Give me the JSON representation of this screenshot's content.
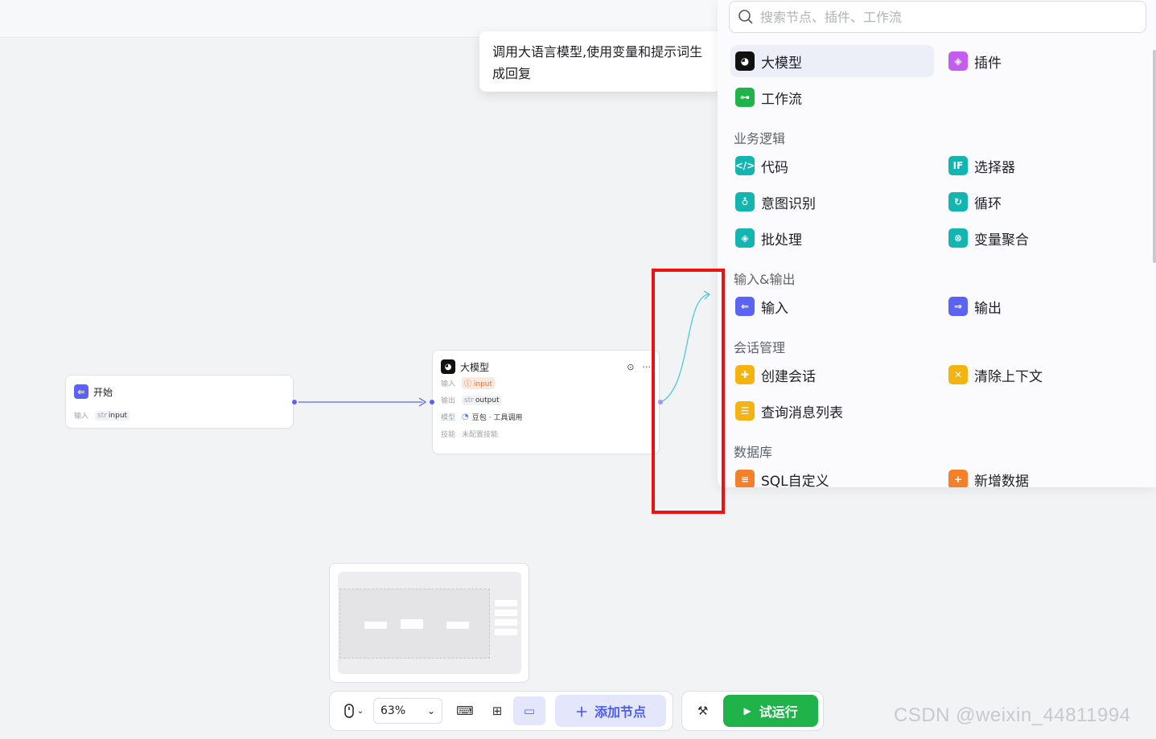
{
  "tooltip": {
    "text": "调用大语言模型,使用变量和提示词生成回复"
  },
  "nodes": {
    "start": {
      "title": "开始",
      "input_label": "输入",
      "input_type": "str",
      "input_name": "input"
    },
    "llm": {
      "title": "大模型",
      "input_label": "输入",
      "input_value": "input",
      "output_label": "输出",
      "output_type": "str",
      "output_value": "output",
      "model_label": "模型",
      "model_value": "豆包 · 工具调用",
      "skill_label": "技能",
      "skill_value": "未配置技能"
    }
  },
  "panel": {
    "search_placeholder": "搜索节点、插件、工作流",
    "top_items": [
      {
        "label": "大模型",
        "icon": "llm-icon",
        "color": "#111111"
      },
      {
        "label": "插件",
        "icon": "plugin-icon",
        "color": "#c45cf0"
      },
      {
        "label": "工作流",
        "icon": "workflow-icon",
        "color": "#1fb34a"
      }
    ],
    "sections": [
      {
        "title": "业务逻辑",
        "items": [
          {
            "label": "代码",
            "icon": "code-icon",
            "color": "#13b5b1"
          },
          {
            "label": "选择器",
            "icon": "if-icon",
            "color": "#13b5b1"
          },
          {
            "label": "意图识别",
            "icon": "intent-icon",
            "color": "#13b5b1"
          },
          {
            "label": "循环",
            "icon": "loop-icon",
            "color": "#13b5b1"
          },
          {
            "label": "批处理",
            "icon": "batch-icon",
            "color": "#13b5b1"
          },
          {
            "label": "变量聚合",
            "icon": "variable-merge-icon",
            "color": "#13b5b1"
          }
        ]
      },
      {
        "title": "输入&输出",
        "items": [
          {
            "label": "输入",
            "icon": "input-icon",
            "color": "#5b63f5"
          },
          {
            "label": "输出",
            "icon": "output-icon",
            "color": "#5b63f5"
          }
        ]
      },
      {
        "title": "会话管理",
        "items": [
          {
            "label": "创建会话",
            "icon": "create-conversation-icon",
            "color": "#f5b311"
          },
          {
            "label": "清除上下文",
            "icon": "clear-context-icon",
            "color": "#f5b311"
          },
          {
            "label": "查询消息列表",
            "icon": "message-list-icon",
            "color": "#f5b311"
          }
        ]
      },
      {
        "title": "数据库",
        "items": [
          {
            "label": "SQL自定义",
            "icon": "sql-icon",
            "color": "#f5802b"
          },
          {
            "label": "新增数据",
            "icon": "add-data-icon",
            "color": "#f5802b"
          }
        ]
      }
    ]
  },
  "toolbar": {
    "zoom": "63%",
    "add_node_label": "添加节点",
    "run_label": "试运行"
  },
  "watermark": "CSDN @weixin_44811994",
  "colors": {
    "accent": "#5b63f5",
    "run": "#1fb34a",
    "highlight_box": "#ee1111",
    "connection_line": "#4ec9d9"
  }
}
